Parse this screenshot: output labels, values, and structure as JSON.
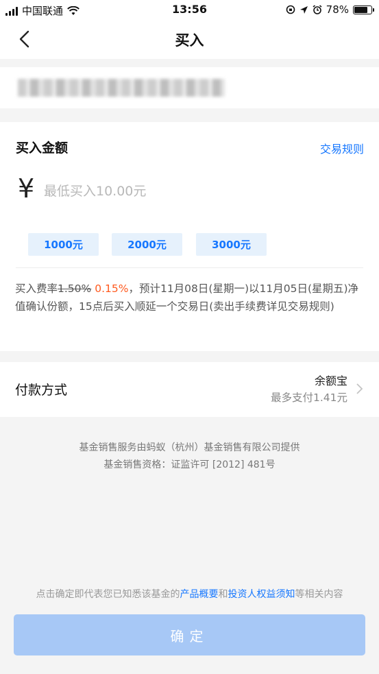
{
  "status_bar": {
    "carrier": "中国联通",
    "time": "13:56",
    "battery": "78%",
    "battery_level": 0.78
  },
  "nav": {
    "title": "买入"
  },
  "purchase": {
    "title": "买入金额",
    "rules_link": "交易规则",
    "currency_symbol": "¥",
    "amount_placeholder": "最低买入10.00元",
    "quick_amounts": [
      "1000元",
      "2000元",
      "3000元"
    ],
    "fee_prefix": "买入费率",
    "fee_original": "1.50%",
    "fee_discount": "0.15%",
    "fee_note": "，预计11月08日(星期一)以11月05日(星期五)净值确认份额，15点后买入顺延一个交易日(卖出手续费详见交易规则)"
  },
  "payment": {
    "label": "付款方式",
    "method": "余额宝",
    "max_pay": "最多支付1.41元"
  },
  "footer_info": {
    "provider": "基金销售服务由蚂蚁（杭州）基金销售有限公司提供",
    "license": "基金销售资格：证监许可 [2012] 481号"
  },
  "agreement": {
    "prefix": "点击确定即代表您已知悉该基金的",
    "link1": "产品概要",
    "middle": "和",
    "link2": "投资人权益须知",
    "suffix": "等相关内容"
  },
  "confirm_button": "确定",
  "colors": {
    "accent": "#1677ff",
    "discount_red": "#ff5a1f",
    "button_disabled": "#a7c8f6"
  }
}
